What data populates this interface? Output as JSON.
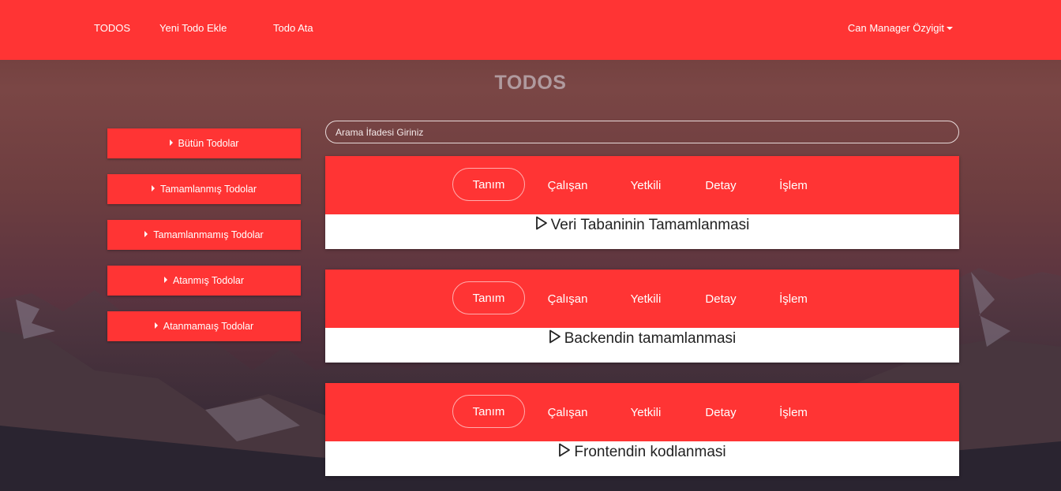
{
  "nav": {
    "links": [
      "TODOS",
      "Yeni Todo Ekle",
      "Todo Ata"
    ],
    "user": "Can Manager Özyigit"
  },
  "page_title": "TODOS",
  "sidebar": {
    "items": [
      "Bütün Todolar",
      "Tamamlanmış Todolar",
      "Tamamlanmamış Todolar",
      "Atanmış Todolar",
      "Atanmamaış Todolar"
    ]
  },
  "search": {
    "placeholder": "Arama İfadesi Giriniz",
    "value": ""
  },
  "tabs": [
    "Tanım",
    "Çalışan",
    "Yetkili",
    "Detay",
    "İşlem"
  ],
  "todos": [
    {
      "active_tab": "Tanım",
      "title": "Veri Tabaninin Tamamlanmasi"
    },
    {
      "active_tab": "Tanım",
      "title": "Backendin tamamlanmasi"
    },
    {
      "active_tab": "Tanım",
      "title": "Frontendin kodlanmasi"
    }
  ],
  "colors": {
    "accent": "#ff3434",
    "card_body": "#ffffff",
    "title": "#b09a9e"
  }
}
